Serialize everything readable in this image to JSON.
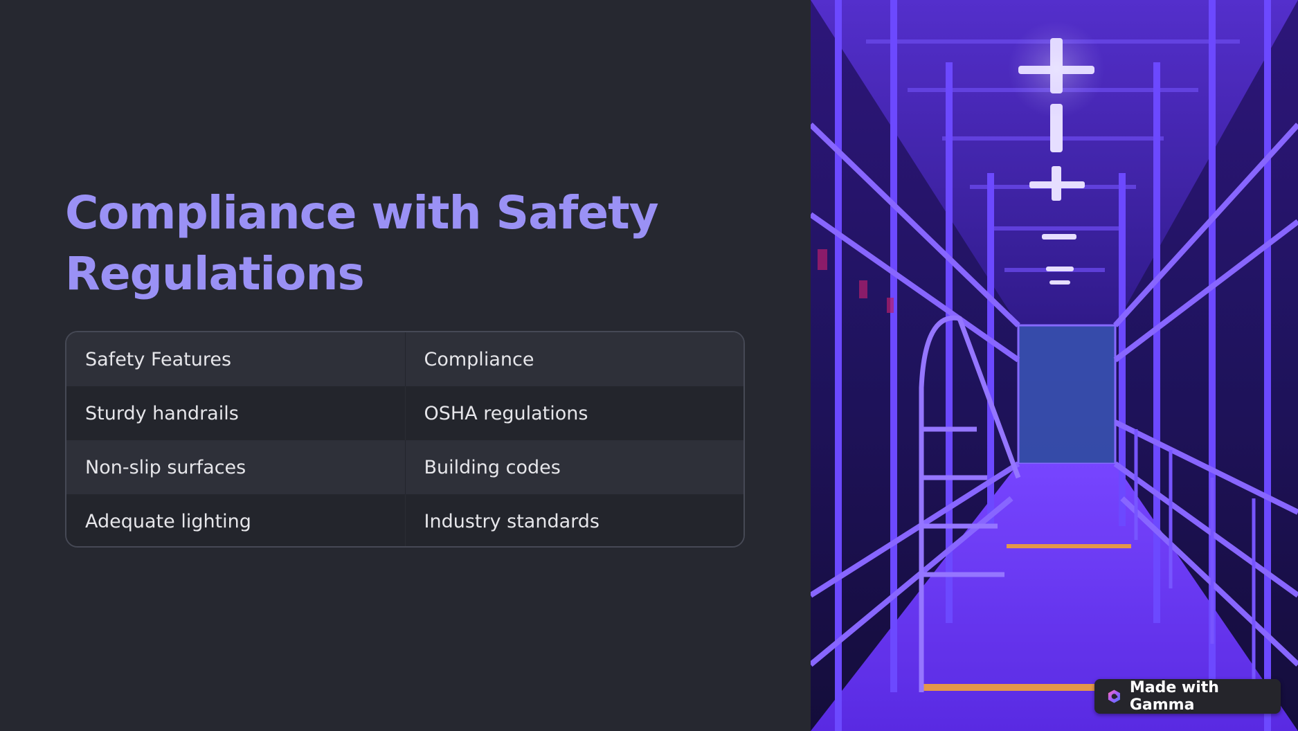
{
  "title": "Compliance with Safety Regulations",
  "table": {
    "header": [
      "Safety Features",
      "Compliance"
    ],
    "rows": [
      [
        "Sturdy handrails",
        "OSHA regulations"
      ],
      [
        "Non-slip surfaces",
        "Building codes"
      ],
      [
        "Adequate lighting",
        "Industry standards"
      ]
    ]
  },
  "badge": {
    "label": "Made with Gamma",
    "icon": "gamma-logo-icon"
  },
  "colors": {
    "background": "#262830",
    "accent": "#9a91f5",
    "photo_tint": "#7b3cff"
  }
}
